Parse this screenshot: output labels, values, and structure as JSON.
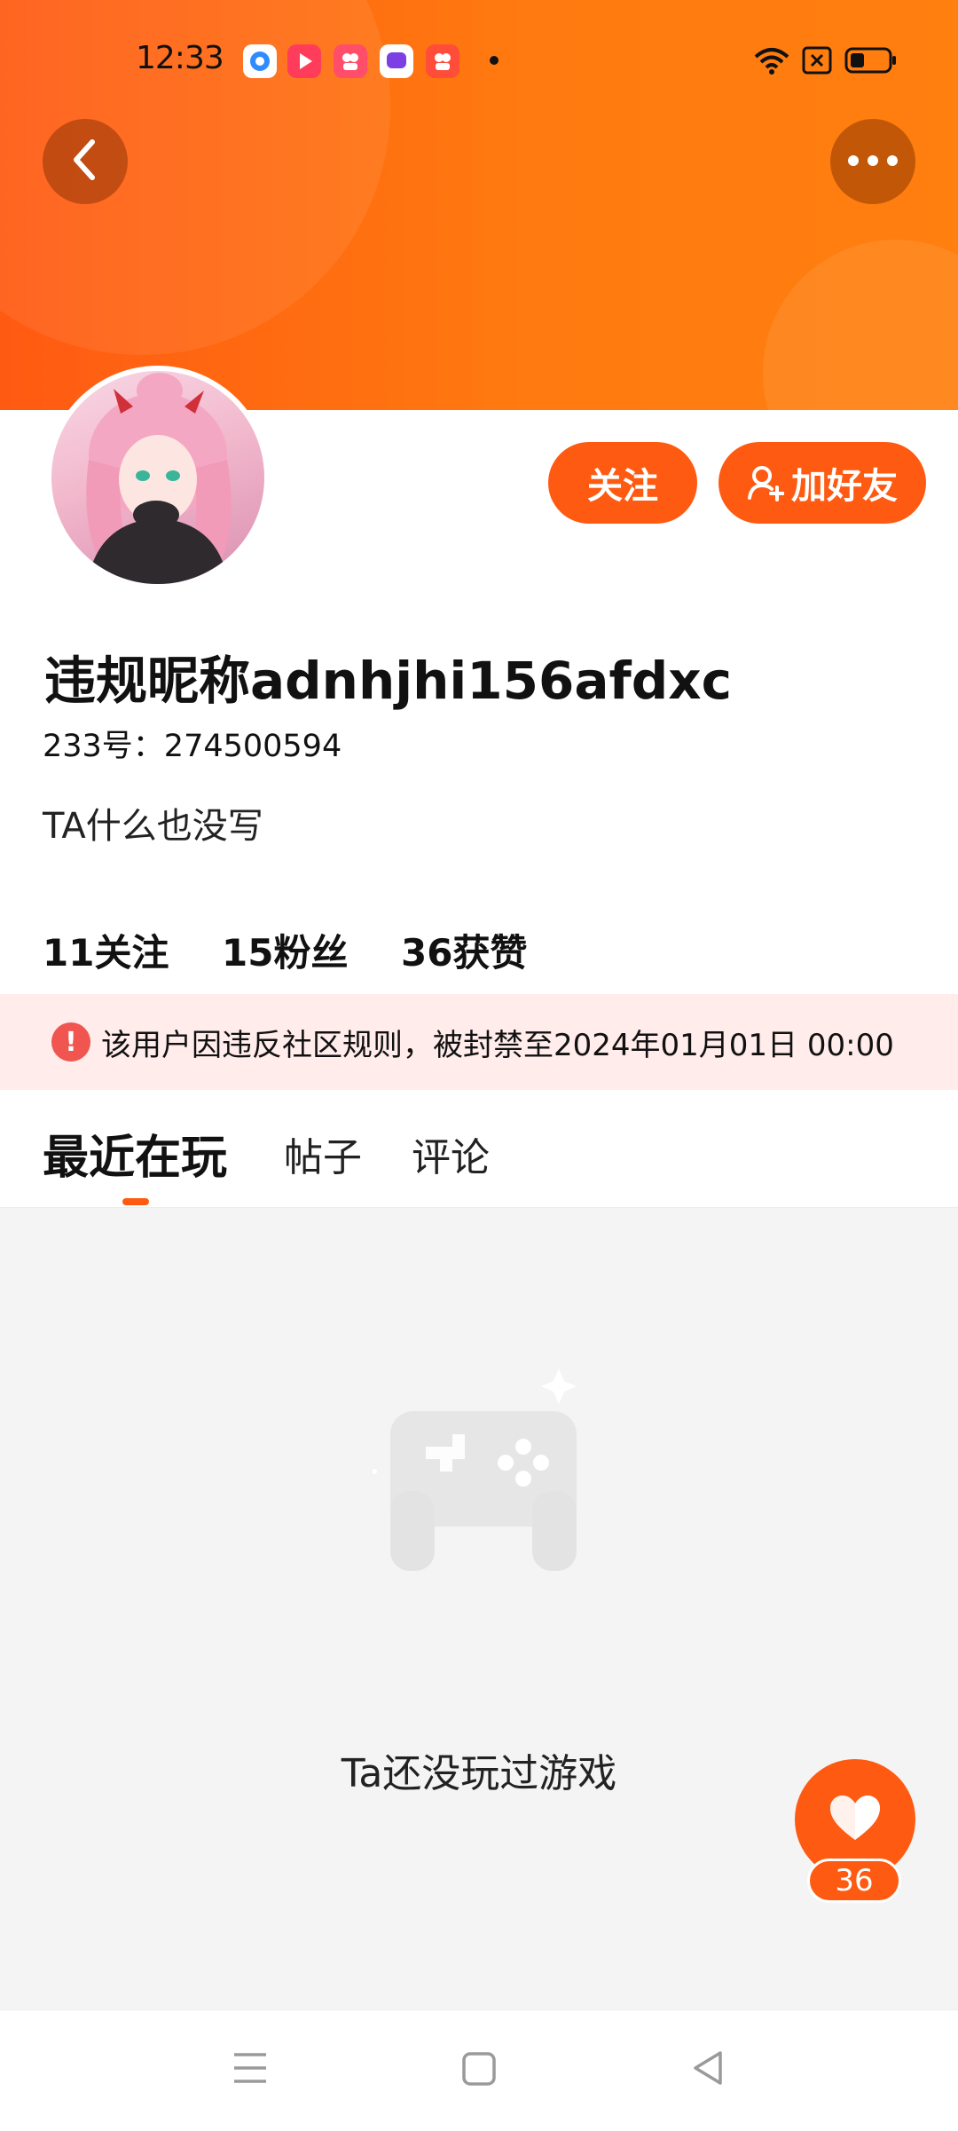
{
  "status_bar": {
    "time": "12:33",
    "battery_icon": "battery-icon",
    "wifi_icon": "wifi-icon",
    "sim_icon": "sim-error-icon"
  },
  "header": {
    "back_icon": "chevron-left-icon",
    "more_icon": "more-horizontal-icon"
  },
  "profile": {
    "name": "违规昵称adnhjhi156afdxc",
    "id_line": "233号：274500594",
    "bio": "TA什么也没写",
    "follow_button": "关注",
    "add_friend_button": "加好友"
  },
  "stats": [
    {
      "value": "11",
      "label": "关注"
    },
    {
      "value": "15",
      "label": "粉丝"
    },
    {
      "value": "36",
      "label": "获赞"
    }
  ],
  "ban_notice": {
    "text": "该用户因违反社区规则，被封禁至2024年01月01日 00:00"
  },
  "tabs": [
    {
      "label": "最近在玩"
    },
    {
      "label": "帖子"
    },
    {
      "label": "评论"
    }
  ],
  "empty_state": {
    "text": "Ta还没玩过游戏"
  },
  "like": {
    "count": "36"
  },
  "colors": {
    "accent": "#ff5a12",
    "ban_bg": "#ffeceb",
    "ban_icon": "#f05550"
  }
}
